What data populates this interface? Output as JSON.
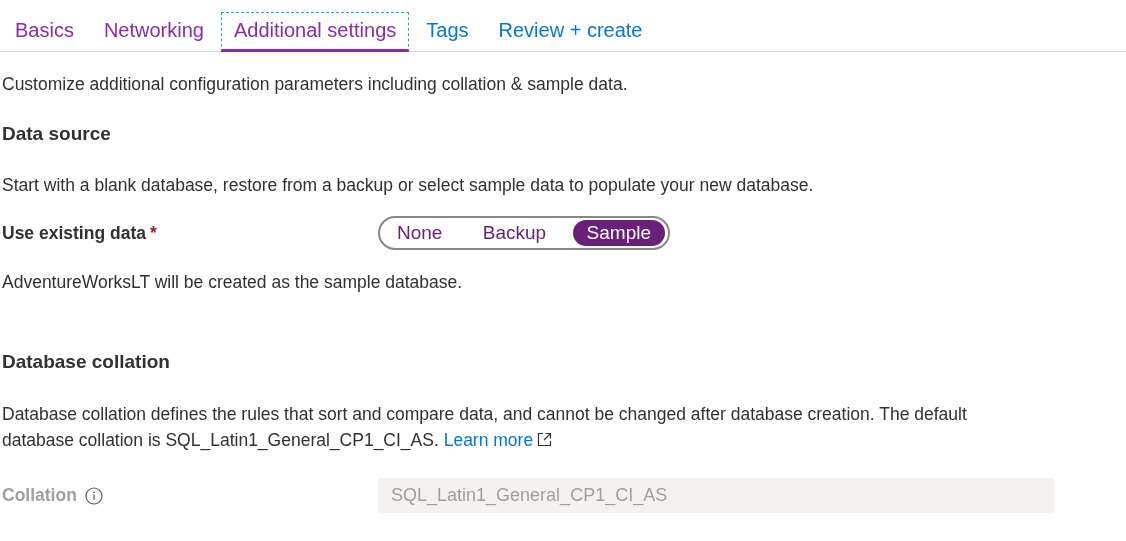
{
  "tabs": [
    {
      "label": "Basics",
      "selected": false,
      "visited": true
    },
    {
      "label": "Networking",
      "selected": false,
      "visited": true
    },
    {
      "label": "Additional settings",
      "selected": true,
      "visited": true
    },
    {
      "label": "Tags",
      "selected": false,
      "visited": false
    },
    {
      "label": "Review + create",
      "selected": false,
      "visited": false
    }
  ],
  "intro": "Customize additional configuration parameters including collation & sample data.",
  "data_source": {
    "heading": "Data source",
    "description": "Start with a blank database, restore from a backup or select sample data to populate your new database.",
    "field": {
      "label": "Use existing data",
      "required_mark": "*",
      "options": [
        {
          "label": "None",
          "selected": false
        },
        {
          "label": "Backup",
          "selected": false
        },
        {
          "label": "Sample",
          "selected": true
        }
      ]
    },
    "note": "AdventureWorksLT will be created as the sample database."
  },
  "database_collation": {
    "heading": "Database collation",
    "description": "Database collation defines the rules that sort and compare data, and cannot be changed after database creation. The default database collation is SQL_Latin1_General_CP1_CI_AS.",
    "link": "Learn more",
    "field": {
      "label": "Collation",
      "value": "SQL_Latin1_General_CP1_CI_AS",
      "disabled": true
    }
  }
}
